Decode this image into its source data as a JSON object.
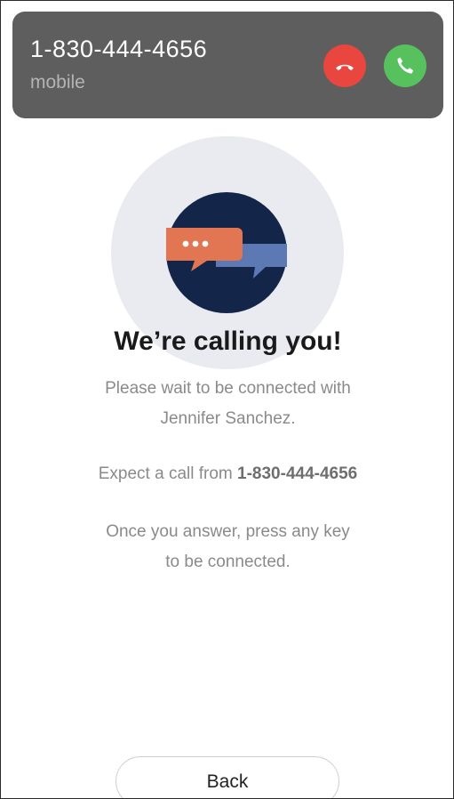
{
  "incoming_call": {
    "number": "1-830-444-4656",
    "type": "mobile",
    "decline_icon": "phone-hangup-icon",
    "accept_icon": "phone-icon",
    "decline_color": "#e8463f",
    "accept_color": "#57c25d"
  },
  "illustration": {
    "icon": "chat-bubbles-icon",
    "colors": {
      "circle": "#14254a",
      "bubble_front": "#e27552",
      "bubble_back": "#5d79b4",
      "halo": "#e9ebf1"
    }
  },
  "main": {
    "headline": "We’re calling you!",
    "wait_line1": "Please wait to be connected with",
    "wait_line2": "Jennifer Sanchez.",
    "expect_prefix": "Expect a call from ",
    "expect_number": "1-830-444-4656",
    "answer_line1": "Once you answer, press any key",
    "answer_line2": "to be connected."
  },
  "footer": {
    "back_label": "Back"
  }
}
